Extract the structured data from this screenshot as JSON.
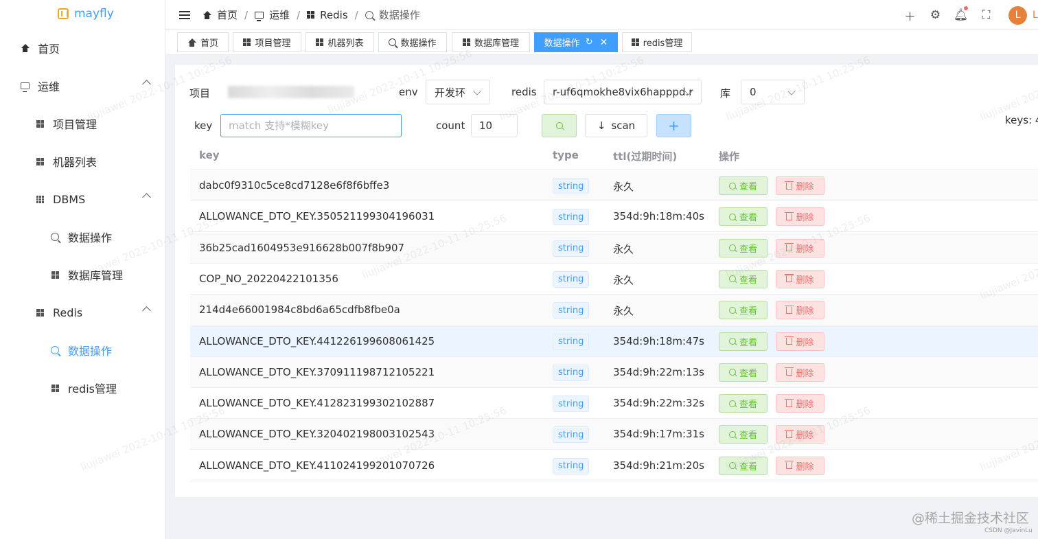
{
  "app": {
    "name": "mayfly"
  },
  "sidebar": {
    "items": [
      {
        "label": "首页",
        "icon": "home-icon"
      },
      {
        "label": "运维",
        "icon": "monitor-icon"
      },
      {
        "label": "项目管理",
        "icon": "grid-icon"
      },
      {
        "label": "机器列表",
        "icon": "grid-icon"
      },
      {
        "label": "DBMS",
        "icon": "grid9-icon"
      },
      {
        "label": "数据操作",
        "icon": "search-icon"
      },
      {
        "label": "数据库管理",
        "icon": "grid-icon"
      },
      {
        "label": "Redis",
        "icon": "grid-icon"
      },
      {
        "label": "数据操作",
        "icon": "search-icon",
        "active": true
      },
      {
        "label": "redis管理",
        "icon": "grid-icon"
      }
    ]
  },
  "header": {
    "breadcrumb": [
      "首页",
      "运维",
      "Redis",
      "数据操作"
    ],
    "avatar_letter": "L"
  },
  "tabs": [
    {
      "label": "首页"
    },
    {
      "label": "项目管理"
    },
    {
      "label": "机器列表"
    },
    {
      "label": "数据操作"
    },
    {
      "label": "数据库管理"
    },
    {
      "label": "数据操作",
      "active": true
    },
    {
      "label": "redis管理"
    }
  ],
  "filters": {
    "project_label": "项目",
    "env_label": "env",
    "env_value": "开发环",
    "redis_label": "redis",
    "redis_value": "r-uf6qmokhe8vix6happpd.r",
    "db_label": "库",
    "db_value": "0",
    "key_label": "key",
    "key_placeholder": "match 支持*模糊key",
    "count_label": "count",
    "count_value": "10",
    "scan_label": "scan",
    "add_label": "+",
    "keys_count": "keys: 4"
  },
  "table": {
    "columns": [
      "key",
      "type",
      "ttl(过期时间)",
      "操作"
    ],
    "view_label": "查看",
    "delete_label": "删除",
    "rows": [
      {
        "key": "dabc0f9310c5ce8cd7128e6f8f6bffe3",
        "type": "string",
        "ttl": "永久"
      },
      {
        "key": "ALLOWANCE_DTO_KEY.350521199304196031",
        "type": "string",
        "ttl": "354d:9h:18m:40s"
      },
      {
        "key": "36b25cad1604953e916628b007f8b907",
        "type": "string",
        "ttl": "永久"
      },
      {
        "key": "COP_NO_20220422101356",
        "type": "string",
        "ttl": "永久"
      },
      {
        "key": "214d4e66001984c8bd6a65cdfb8fbe0a",
        "type": "string",
        "ttl": "永久"
      },
      {
        "key": "ALLOWANCE_DTO_KEY.441226199608061425",
        "type": "string",
        "ttl": "354d:9h:18m:47s"
      },
      {
        "key": "ALLOWANCE_DTO_KEY.370911198712105221",
        "type": "string",
        "ttl": "354d:9h:22m:13s"
      },
      {
        "key": "ALLOWANCE_DTO_KEY.412823199302102887",
        "type": "string",
        "ttl": "354d:9h:22m:32s"
      },
      {
        "key": "ALLOWANCE_DTO_KEY.320402198003102543",
        "type": "string",
        "ttl": "354d:9h:17m:31s"
      },
      {
        "key": "ALLOWANCE_DTO_KEY.411024199201070726",
        "type": "string",
        "ttl": "354d:9h:21m:20s"
      }
    ]
  },
  "watermark": "liujiawei 2022-10-11 10:25:56",
  "footer": {
    "brand": "@稀土掘金技术社区",
    "credit": "CSDN @JavinLu"
  }
}
